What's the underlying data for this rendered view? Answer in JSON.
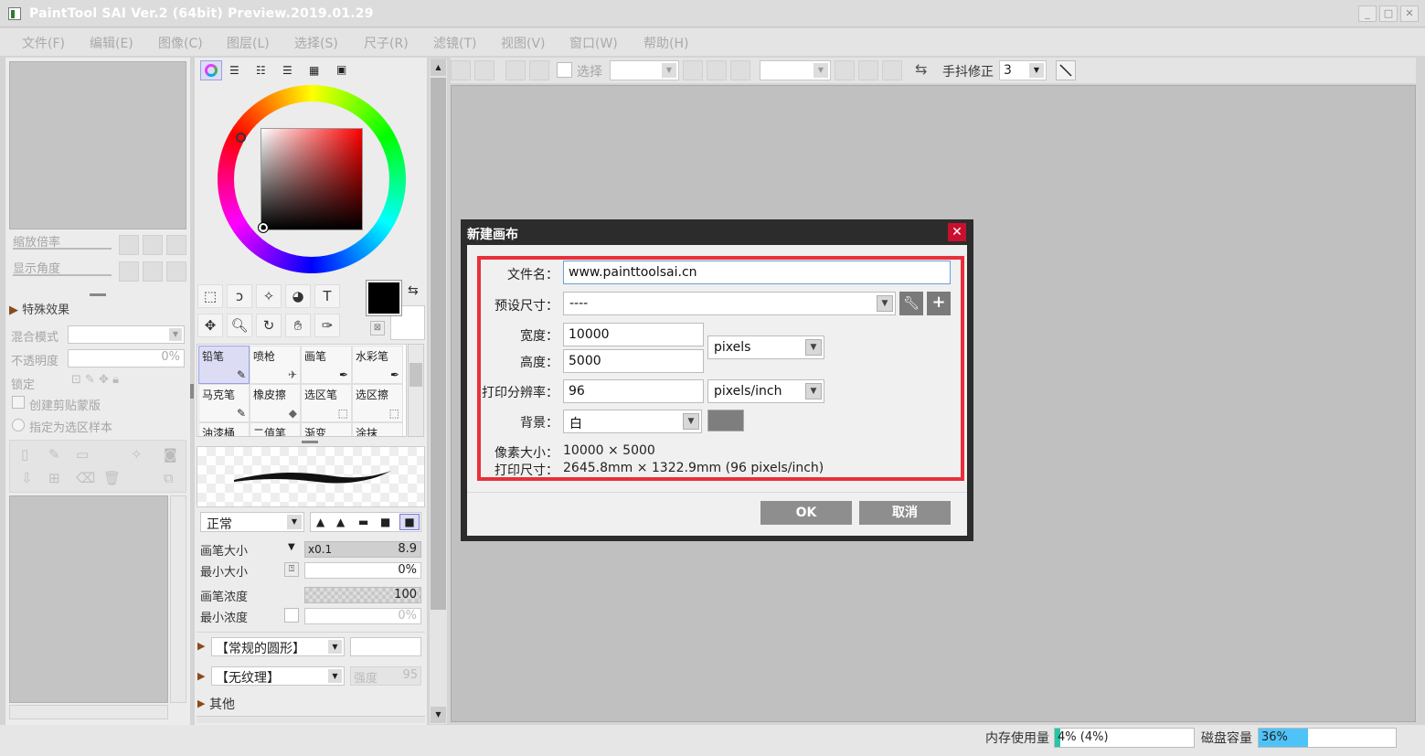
{
  "window": {
    "title": "PaintTool SAI Ver.2 (64bit) Preview.2019.01.29",
    "buttons": [
      "_",
      "□",
      "✕"
    ]
  },
  "menu": [
    "文件(F)",
    "编辑(E)",
    "图像(C)",
    "图层(L)",
    "选择(S)",
    "尺子(R)",
    "滤镜(T)",
    "视图(V)",
    "窗口(W)",
    "帮助(H)"
  ],
  "navigator": {
    "zoom_label": "缩放倍率",
    "angle_label": "显示角度"
  },
  "layer_panel": {
    "effects_label": "特殊效果",
    "blend_label": "混合模式",
    "opacity_label": "不透明度",
    "opacity_value": "0%",
    "lock_label": "锁定",
    "clip_label": "创建剪贴蒙版",
    "sample_label": "指定为选区样本"
  },
  "tools": {
    "text_tool": "T",
    "brushes": [
      {
        "name": "铅笔",
        "selected": true
      },
      {
        "name": "喷枪"
      },
      {
        "name": "画笔"
      },
      {
        "name": "水彩笔"
      },
      {
        "name": "马克笔"
      },
      {
        "name": "橡皮擦"
      },
      {
        "name": "选区笔"
      },
      {
        "name": "选区擦"
      },
      {
        "name": "油漆桶"
      },
      {
        "name": "二值笔"
      },
      {
        "name": "渐变"
      },
      {
        "name": "涂抹"
      }
    ],
    "blend_mode": "正常",
    "brush_size_label": "画笔大小",
    "brush_size_mult": "x0.1",
    "brush_size_value": "8.9",
    "min_size_label": "最小大小",
    "min_size_value": "0%",
    "density_label": "画笔浓度",
    "density_value": "100",
    "min_density_label": "最小浓度",
    "min_density_value": "0%",
    "shape_select": "【常规的圆形】",
    "texture_select": "【无纹理】",
    "strength_label": "强度",
    "strength_value": "95",
    "other_label": "其他"
  },
  "toolbar": {
    "select_label": "选择",
    "stabilizer_label": "手抖修正",
    "stabilizer_value": "3"
  },
  "dialog": {
    "title": "新建画布",
    "close": "✕",
    "filename_label": "文件名：",
    "filename_value": "www.painttoolsai.cn",
    "preset_label": "预设尺寸：",
    "preset_value": "----",
    "width_label": "宽度：",
    "width_value": "10000",
    "height_label": "高度：",
    "height_value": "5000",
    "unit_value": "pixels",
    "resolution_label": "打印分辨率：",
    "resolution_value": "96",
    "resolution_unit": "pixels/inch",
    "bg_label": "背景：",
    "bg_value": "白",
    "pixel_size_label": "像素大小：",
    "pixel_size_value": "10000 × 5000",
    "print_size_label": "打印尺寸：",
    "print_size_value": "2645.8mm × 1322.9mm (96 pixels/inch)",
    "ok_label": "OK",
    "cancel_label": "取消"
  },
  "status": {
    "memory_label": "内存使用量",
    "memory_value": "4% (4%)",
    "memory_fraction": 0.04,
    "disk_label": "磁盘容量",
    "disk_value": "36%",
    "disk_fraction": 0.36
  },
  "colors": {
    "accent_red": "#e8303a",
    "close_red": "#c8102e",
    "disk_fill": "#4fc3f7",
    "memory_fill": "#26c6a6"
  }
}
